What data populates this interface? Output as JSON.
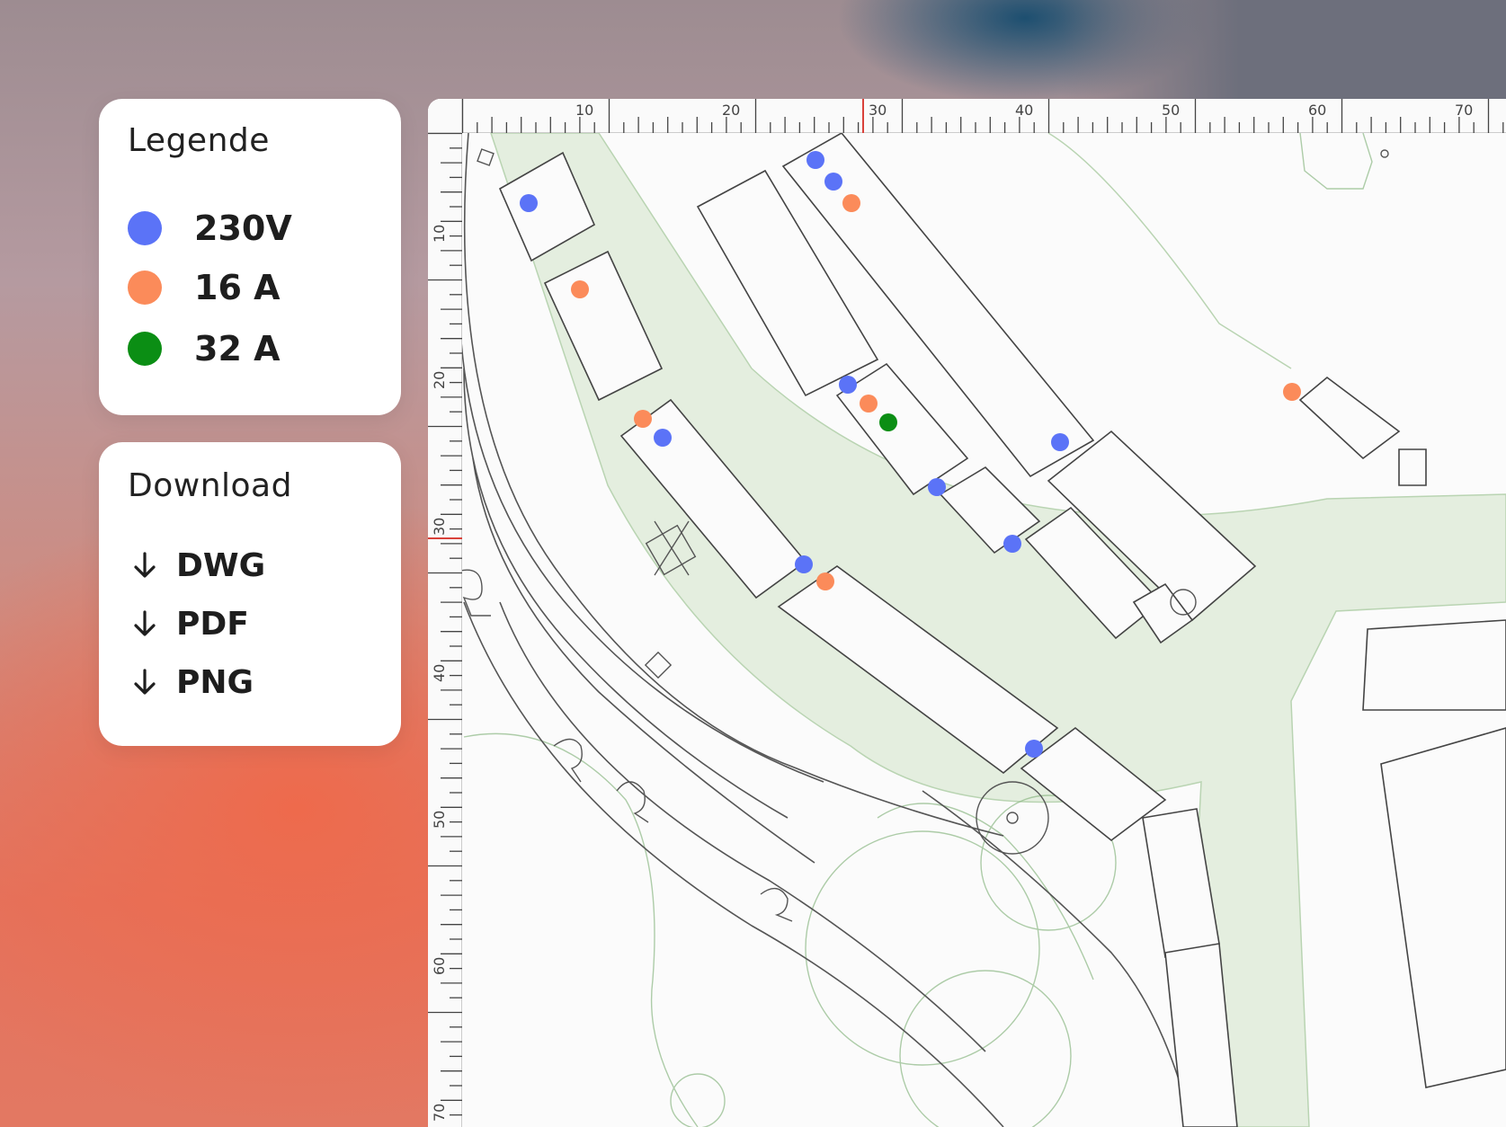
{
  "legend": {
    "title": "Legende",
    "items": [
      {
        "label": "230V",
        "color": "#5b73f7"
      },
      {
        "label": "16 A",
        "color": "#fb8b5a"
      },
      {
        "label": "32 A",
        "color": "#0b8e14"
      }
    ]
  },
  "download": {
    "title": "Download",
    "items": [
      {
        "label": "DWG",
        "icon": "arrow-down-icon"
      },
      {
        "label": "PDF",
        "icon": "arrow-down-icon"
      },
      {
        "label": "PNG",
        "icon": "arrow-down-icon"
      }
    ]
  },
  "ruler": {
    "top_labels": [
      "10",
      "20",
      "30",
      "40",
      "50",
      "60",
      "70"
    ],
    "left_labels": [
      "10",
      "20",
      "30",
      "40",
      "50",
      "60",
      "70"
    ],
    "marker_value": "30",
    "marker_color": "#d9413a"
  },
  "colors": {
    "green_band": "#e4eedf",
    "green_line": "#8cb884",
    "building_stroke": "#444444"
  }
}
